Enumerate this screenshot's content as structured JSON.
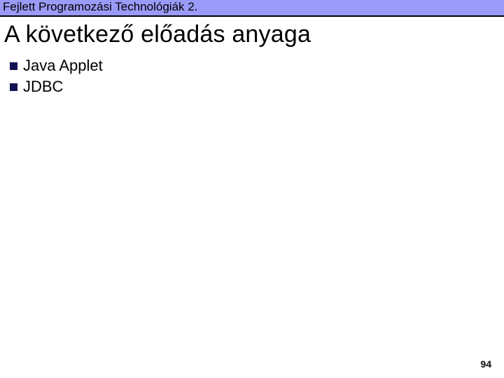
{
  "header": {
    "text": "Fejlett Programozási Technológiák 2."
  },
  "title": "A következő előadás anyaga",
  "bullets": {
    "items": [
      {
        "label": "Java Applet"
      },
      {
        "label": "JDBC"
      }
    ]
  },
  "page_number": "94"
}
